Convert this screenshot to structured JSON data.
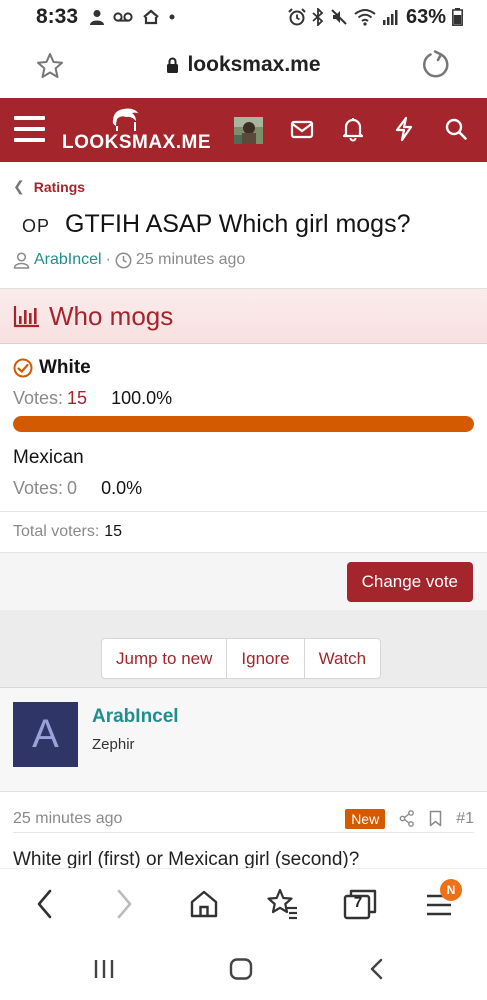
{
  "status_bar": {
    "time": "8:33",
    "battery": "63%"
  },
  "browser": {
    "url": "looksmax.me",
    "tabs_count": "7",
    "menu_badge": "N"
  },
  "site": {
    "logo_text": "LOOKSMAX.ME",
    "accent_color": "#a4262c"
  },
  "breadcrumb": {
    "label": "Ratings"
  },
  "thread": {
    "prefix": "OP",
    "title": "GTFIH ASAP Which girl mogs?",
    "author": "ArabIncel",
    "time_ago": "25 minutes ago"
  },
  "poll": {
    "title": "Who mogs",
    "options": [
      {
        "name": "White",
        "votes_label": "Votes:",
        "votes": "15",
        "percent": "100.0%",
        "fill_fraction": 1.0,
        "selected": true
      },
      {
        "name": "Mexican",
        "votes_label": "Votes:",
        "votes": "0",
        "percent": "0.0%",
        "fill_fraction": 0.0,
        "selected": false
      }
    ],
    "total_label": "Total voters:",
    "total_voters": "15",
    "change_vote_label": "Change vote",
    "bar_color": "#d45a00"
  },
  "thread_actions": {
    "jump_label": "Jump to new",
    "ignore_label": "Ignore",
    "watch_label": "Watch"
  },
  "post": {
    "avatar_letter": "A",
    "username": "ArabIncel",
    "user_title": "Zephir",
    "time_ago": "25 minutes ago",
    "badge": "New",
    "number": "#1",
    "body": "White girl (first) or Mexican girl (second)?"
  }
}
